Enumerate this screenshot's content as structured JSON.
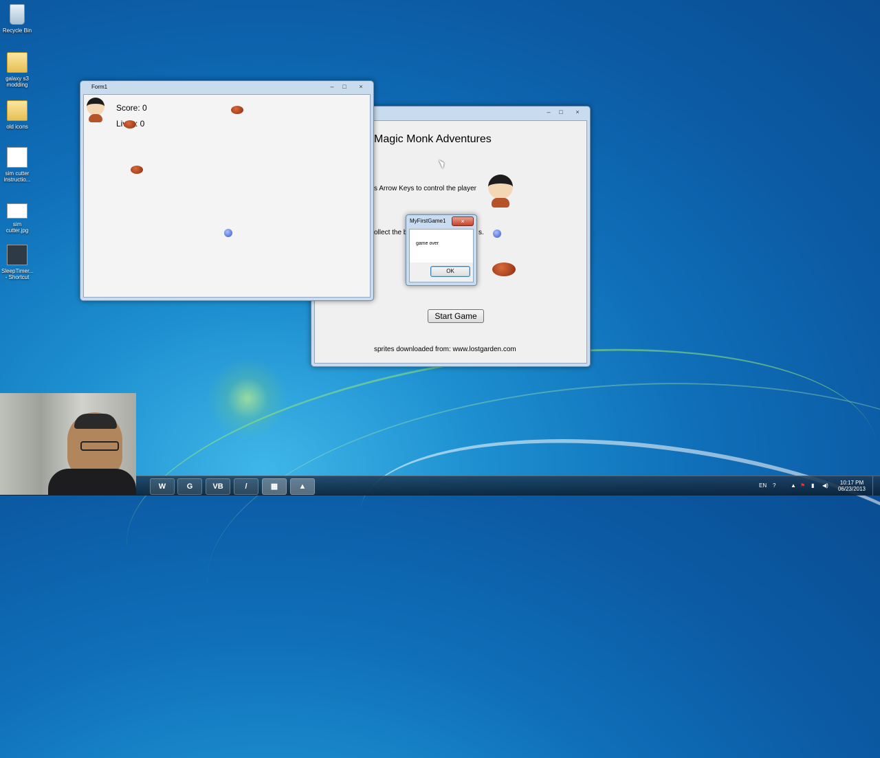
{
  "desktop": {
    "icons": [
      {
        "label": "Recycle Bin",
        "icon": "recycle-bin-icon"
      },
      {
        "label": "galaxy s3 modding",
        "icon": "folder-icon"
      },
      {
        "label": "old icons",
        "icon": "folder-icon"
      },
      {
        "label": "sim cutter instructio...",
        "icon": "document-icon"
      },
      {
        "label": "sim cutter.jpg",
        "icon": "image-file-icon"
      },
      {
        "label": "SleepTimer... - Shortcut",
        "icon": "shortcut-icon"
      }
    ]
  },
  "game_window": {
    "title": "Form1",
    "score_label": "Score: 0",
    "lives_label": "Lives: 0",
    "controls": {
      "minimize": "–",
      "maximize": "□",
      "close": "×"
    }
  },
  "menu_window": {
    "heading": "Magic Monk Adventures",
    "instruction_arrows": "s Arrow Keys to control the player",
    "instruction_collect": "ollect the b",
    "instruction_collect_tail": "s.",
    "start_button": "Start Game",
    "credits": "sprites downloaded from: www.lostgarden.com",
    "controls": {
      "minimize": "–",
      "maximize": "□",
      "close": "×"
    }
  },
  "dialog": {
    "title": "MyFirstGame1",
    "message": "game over",
    "ok_button": "OK",
    "close": "×"
  },
  "taskbar": {
    "apps": [
      {
        "label": "W",
        "icon": "word-icon",
        "color": "#2b5797"
      },
      {
        "label": "G",
        "icon": "green-app-icon",
        "color": "#3a8a3a"
      },
      {
        "label": "VB",
        "icon": "visual-basic-icon",
        "color": "#1f5fa8"
      },
      {
        "label": "/",
        "icon": "pencil-app-icon",
        "color": "#e07b20"
      },
      {
        "label": "▦",
        "icon": "windows-app-icon",
        "color": "#f0b000"
      },
      {
        "label": "▲",
        "icon": "game-app-icon",
        "color": "#666666"
      }
    ],
    "tray": {
      "language": "EN",
      "time": "10:17 PM",
      "date": "06/23/2013"
    }
  }
}
